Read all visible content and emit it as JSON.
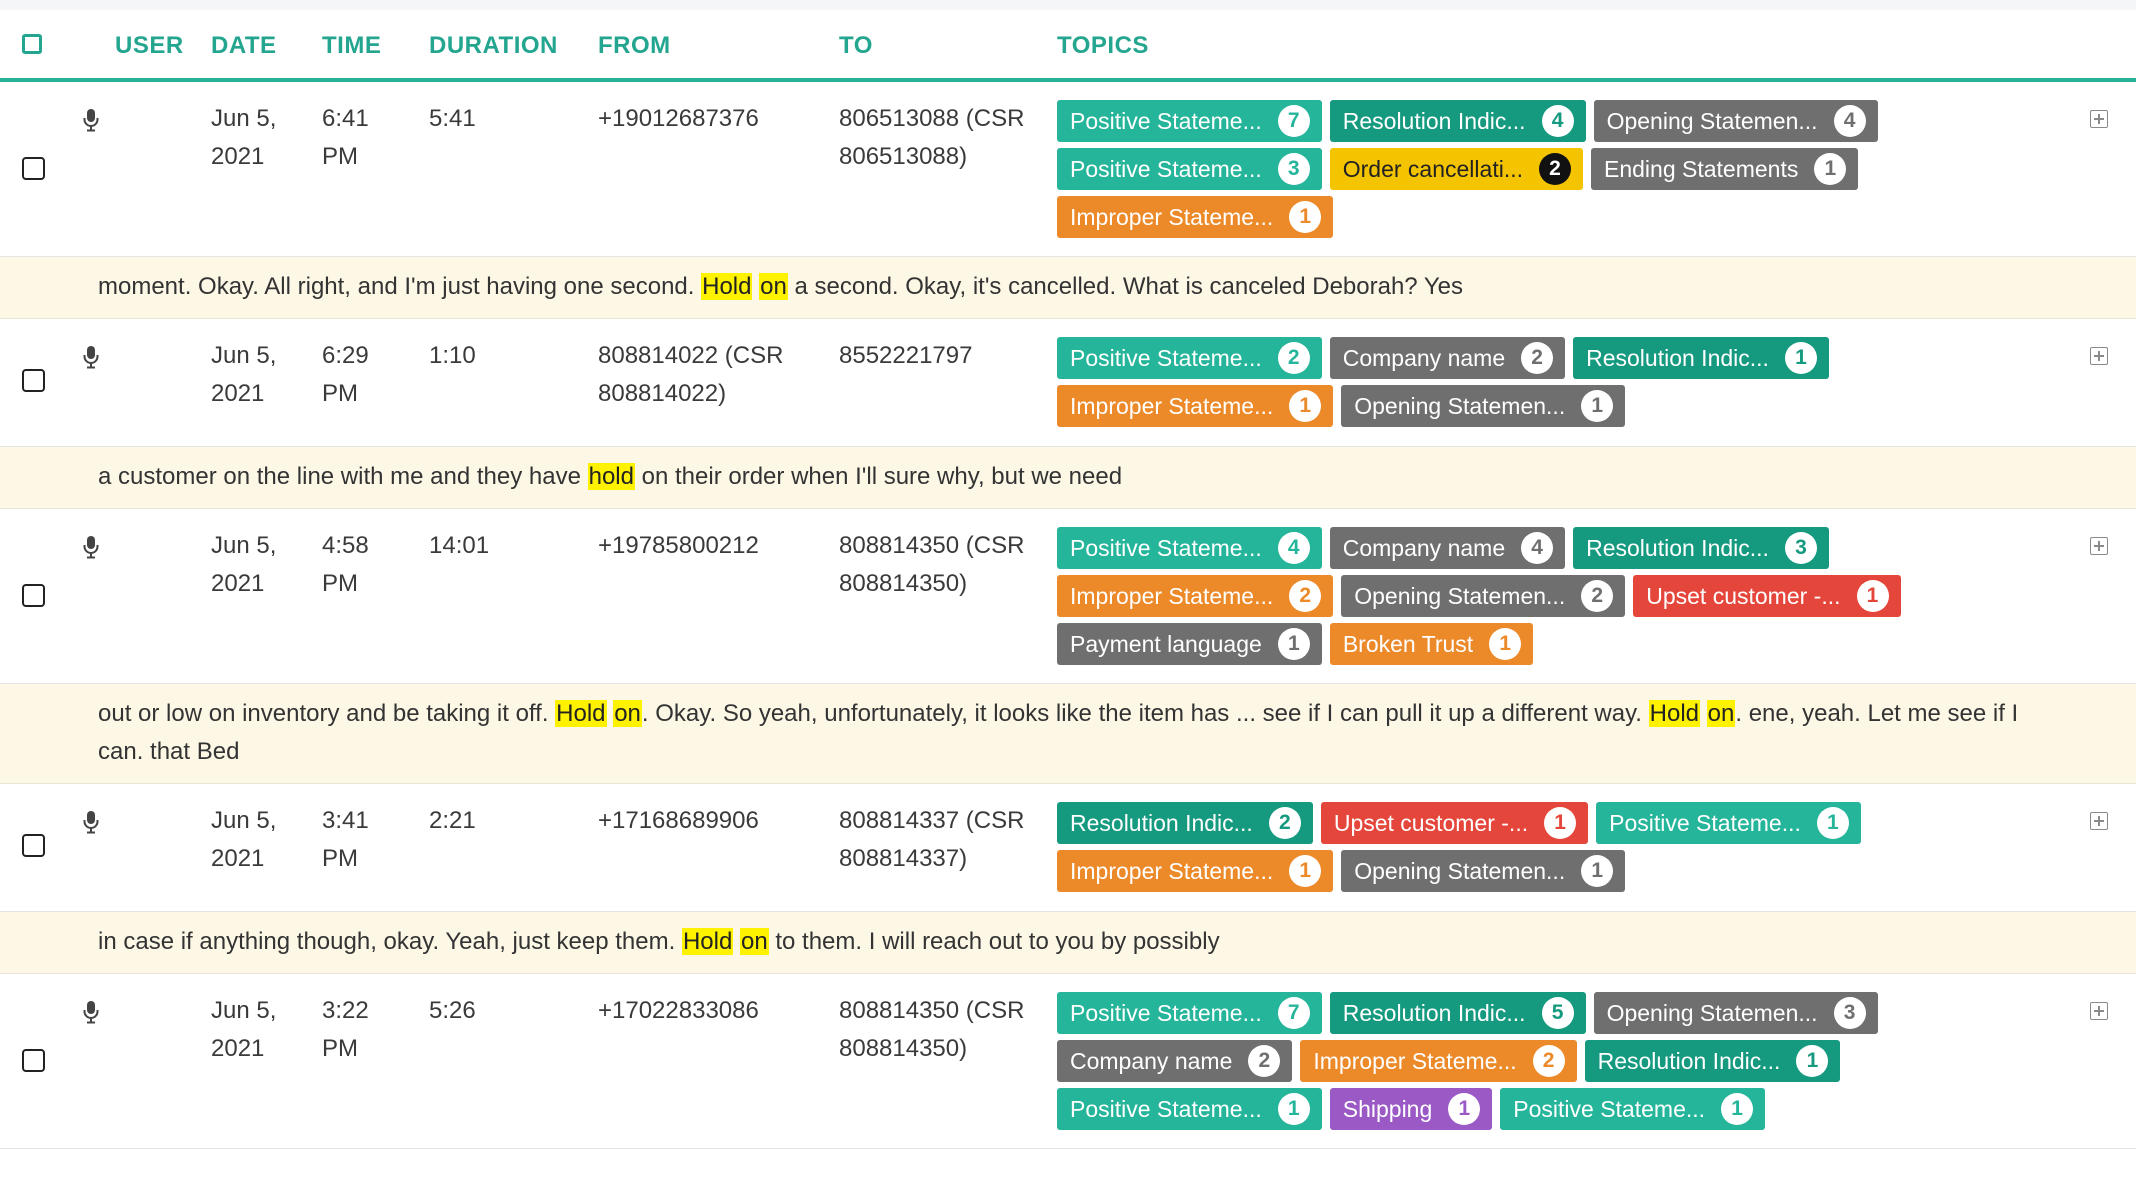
{
  "header": {
    "columns": [
      "USER",
      "DATE",
      "TIME",
      "DURATION",
      "FROM",
      "TO",
      "TOPICS"
    ]
  },
  "colors": {
    "accent": "#23a58f",
    "snippet_bg": "#fdf7e6",
    "highlight": "#fff200"
  },
  "rows": [
    {
      "date1": "Jun 5,",
      "date2": "2021",
      "time1": "6:41",
      "time2": "PM",
      "duration": "5:41",
      "from1": "+19012687376",
      "from2": "",
      "to1": "806513088 (CSR",
      "to2": "806513088)",
      "topics": [
        {
          "label": "Positive Stateme...",
          "count": "7",
          "color": "teal"
        },
        {
          "label": "Resolution Indic...",
          "count": "4",
          "color": "dteal"
        },
        {
          "label": "Opening Statemen...",
          "count": "4",
          "color": "gray"
        },
        {
          "label": "Positive Stateme...",
          "count": "3",
          "color": "teal"
        },
        {
          "label": "Order cancellati...",
          "count": "2",
          "color": "yellow"
        },
        {
          "label": "Ending Statements",
          "count": "1",
          "color": "gray"
        },
        {
          "label": "Improper Stateme...",
          "count": "1",
          "color": "orange"
        }
      ],
      "snippet": [
        {
          "t": "moment. Okay. All right, and I'm just having one second. "
        },
        {
          "t": "Hold",
          "h": true
        },
        {
          "t": " "
        },
        {
          "t": "on",
          "h": true
        },
        {
          "t": " a second. Okay, it's cancelled. What is canceled Deborah? Yes"
        }
      ]
    },
    {
      "date1": "Jun 5,",
      "date2": "2021",
      "time1": "6:29",
      "time2": "PM",
      "duration": "1:10",
      "from1": "808814022 (CSR",
      "from2": "808814022)",
      "to1": "8552221797",
      "to2": "",
      "topics": [
        {
          "label": "Positive Stateme...",
          "count": "2",
          "color": "teal"
        },
        {
          "label": "Company name",
          "count": "2",
          "color": "gray"
        },
        {
          "label": "Resolution Indic...",
          "count": "1",
          "color": "dteal"
        },
        {
          "label": "Improper Stateme...",
          "count": "1",
          "color": "orange"
        },
        {
          "label": "Opening Statemen...",
          "count": "1",
          "color": "gray"
        }
      ],
      "snippet": [
        {
          "t": "a customer on the line with me and they have "
        },
        {
          "t": "hold",
          "h": true
        },
        {
          "t": " on their order when I'll sure why, but we need"
        }
      ]
    },
    {
      "date1": "Jun 5,",
      "date2": "2021",
      "time1": "4:58",
      "time2": "PM",
      "duration": "14:01",
      "from1": "+19785800212",
      "from2": "",
      "to1": "808814350 (CSR",
      "to2": "808814350)",
      "topics": [
        {
          "label": "Positive Stateme...",
          "count": "4",
          "color": "teal"
        },
        {
          "label": "Company name",
          "count": "4",
          "color": "gray"
        },
        {
          "label": "Resolution Indic...",
          "count": "3",
          "color": "dteal"
        },
        {
          "label": "Improper Stateme...",
          "count": "2",
          "color": "orange"
        },
        {
          "label": "Opening Statemen...",
          "count": "2",
          "color": "gray"
        },
        {
          "label": "Upset customer -...",
          "count": "1",
          "color": "red"
        },
        {
          "label": "Payment language",
          "count": "1",
          "color": "gray"
        },
        {
          "label": "Broken Trust",
          "count": "1",
          "color": "orange"
        }
      ],
      "snippet": [
        {
          "t": "out or low on inventory and be taking it off. "
        },
        {
          "t": "Hold",
          "h": true
        },
        {
          "t": " "
        },
        {
          "t": "on",
          "h": true
        },
        {
          "t": ". Okay. So yeah, unfortunately, it looks like the item has ... see if I can pull it up a different way. "
        },
        {
          "t": "Hold",
          "h": true
        },
        {
          "t": " "
        },
        {
          "t": "on",
          "h": true
        },
        {
          "t": ". ene, yeah. Let me see if I can. that Bed"
        }
      ]
    },
    {
      "date1": "Jun 5,",
      "date2": "2021",
      "time1": "3:41",
      "time2": "PM",
      "duration": "2:21",
      "from1": "+17168689906",
      "from2": "",
      "to1": "808814337 (CSR",
      "to2": "808814337)",
      "topics": [
        {
          "label": "Resolution Indic...",
          "count": "2",
          "color": "dteal"
        },
        {
          "label": "Upset customer -...",
          "count": "1",
          "color": "red"
        },
        {
          "label": "Positive Stateme...",
          "count": "1",
          "color": "teal"
        },
        {
          "label": "Improper Stateme...",
          "count": "1",
          "color": "orange"
        },
        {
          "label": "Opening Statemen...",
          "count": "1",
          "color": "gray"
        }
      ],
      "snippet": [
        {
          "t": "in case if anything though, okay. Yeah, just keep them. "
        },
        {
          "t": "Hold",
          "h": true
        },
        {
          "t": " "
        },
        {
          "t": "on",
          "h": true
        },
        {
          "t": " to them. I will reach out to you by possibly"
        }
      ]
    },
    {
      "date1": "Jun 5,",
      "date2": "2021",
      "time1": "3:22",
      "time2": "PM",
      "duration": "5:26",
      "from1": "+17022833086",
      "from2": "",
      "to1": "808814350 (CSR",
      "to2": "808814350)",
      "topics": [
        {
          "label": "Positive Stateme...",
          "count": "7",
          "color": "teal"
        },
        {
          "label": "Resolution Indic...",
          "count": "5",
          "color": "dteal"
        },
        {
          "label": "Opening Statemen...",
          "count": "3",
          "color": "gray"
        },
        {
          "label": "Company name",
          "count": "2",
          "color": "gray"
        },
        {
          "label": "Improper Stateme...",
          "count": "2",
          "color": "orange"
        },
        {
          "label": "Resolution Indic...",
          "count": "1",
          "color": "dteal"
        },
        {
          "label": "Positive Stateme...",
          "count": "1",
          "color": "teal"
        },
        {
          "label": "Shipping",
          "count": "1",
          "color": "purple"
        },
        {
          "label": "Positive Stateme...",
          "count": "1",
          "color": "teal"
        }
      ]
    }
  ]
}
